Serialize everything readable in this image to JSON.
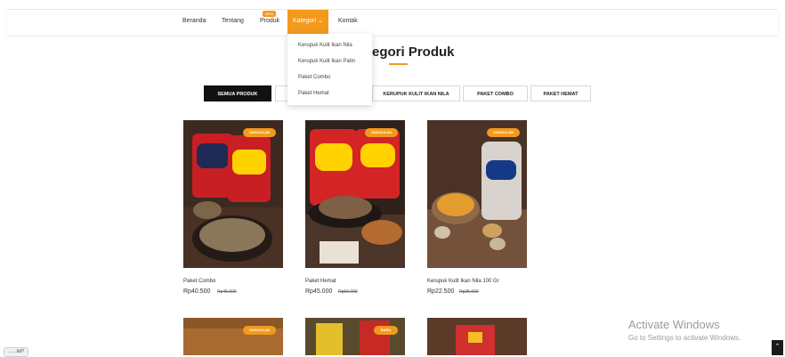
{
  "nav": {
    "items": [
      "Beranda",
      "Tentang",
      "Produk",
      "Kontak"
    ],
    "active": "Kategori ⌄",
    "badge": "NEW"
  },
  "dropdown": [
    "Kerupuk Kulit Ikan Nila",
    "Kerupuk Kulit Ikan Patin",
    "Paket Combo",
    "Paket Hemat"
  ],
  "page": {
    "title": "egori Produk"
  },
  "filters": [
    "SEMUA PRODUK",
    "K",
    "KERUPUK KULIT IKAN NILA",
    "PAKET COMBO",
    "PAKET HEMAT"
  ],
  "products": [
    {
      "name": "Paket Combo",
      "price": "Rp40.500",
      "old_price": "Rp45.000",
      "badge": "UNGGULAN"
    },
    {
      "name": "Paket Hemat",
      "price": "Rp45.000",
      "old_price": "Rp50.000",
      "badge": "UNGGULAN"
    },
    {
      "name": "Kerupuk Kulit Ikan Nila 100 Gr",
      "price": "Rp22.500",
      "old_price": "Rp25.000",
      "badge": "UNGGULAN"
    }
  ],
  "bottom_products": [
    {
      "badge": "UNGGULAN"
    },
    {
      "badge": "BARU"
    },
    {
      "badge": ""
    }
  ],
  "activate_windows": {
    "title": "Activate Windows",
    "subtitle": "Go to Settings to activate Windows."
  },
  "status_url": "... .../id?",
  "colors": {
    "accent": "#f39a1d",
    "dark": "#111111"
  },
  "icons": {
    "scroll_top": "chevron-up-icon",
    "dropdown": "chevron-down-icon"
  }
}
